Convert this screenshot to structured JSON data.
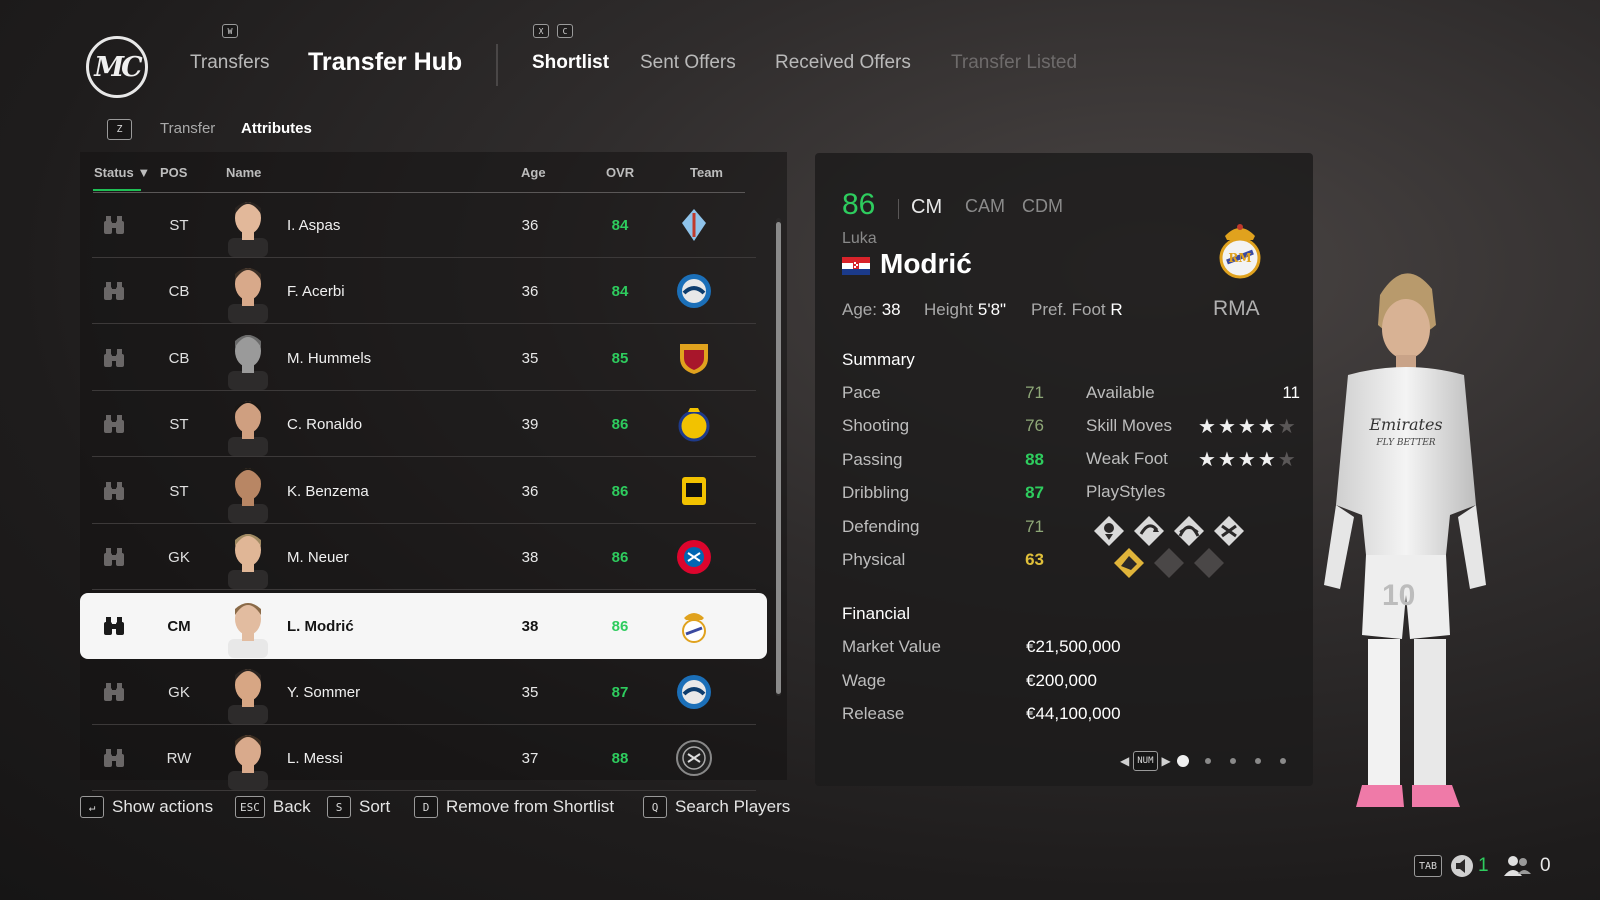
{
  "header": {
    "logo_text": "MC",
    "key_w": "W",
    "key_x": "X",
    "key_c": "C",
    "transfers": "Transfers",
    "title": "Transfer Hub",
    "tabs": [
      {
        "label": "Shortlist",
        "active": true
      },
      {
        "label": "Sent Offers"
      },
      {
        "label": "Received Offers"
      },
      {
        "label": "Transfer Listed",
        "disabled": true
      }
    ]
  },
  "subnav": {
    "key": "Z",
    "items": [
      {
        "label": "Transfer"
      },
      {
        "label": "Attributes",
        "active": true
      }
    ]
  },
  "table": {
    "columns": {
      "status": "Status",
      "pos": "POS",
      "name": "Name",
      "age": "Age",
      "ovr": "OVR",
      "team": "Team"
    },
    "rows": [
      {
        "pos": "ST",
        "name": "I. Aspas",
        "age": "36",
        "ovr": "84",
        "team_icon": "celta-vigo-crest"
      },
      {
        "pos": "CB",
        "name": "F. Acerbi",
        "age": "36",
        "ovr": "84",
        "team_icon": "inter-crest"
      },
      {
        "pos": "CB",
        "name": "M. Hummels",
        "age": "35",
        "ovr": "85",
        "team_icon": "roma-crest"
      },
      {
        "pos": "ST",
        "name": "C. Ronaldo",
        "age": "39",
        "ovr": "86",
        "team_icon": "al-nassr-crest"
      },
      {
        "pos": "ST",
        "name": "K. Benzema",
        "age": "36",
        "ovr": "86",
        "team_icon": "al-ittihad-crest"
      },
      {
        "pos": "GK",
        "name": "M. Neuer",
        "age": "38",
        "ovr": "86",
        "team_icon": "bayern-crest"
      },
      {
        "pos": "CM",
        "name": "L. Modrić",
        "age": "38",
        "ovr": "86",
        "team_icon": "real-madrid-crest",
        "selected": true
      },
      {
        "pos": "GK",
        "name": "Y. Sommer",
        "age": "35",
        "ovr": "87",
        "team_icon": "inter-crest"
      },
      {
        "pos": "RW",
        "name": "L. Messi",
        "age": "37",
        "ovr": "88",
        "team_icon": "inter-miami-crest"
      }
    ]
  },
  "actions": [
    {
      "key": "↵",
      "label": "Show actions"
    },
    {
      "key": "ESC",
      "label": "Back"
    },
    {
      "key": "S",
      "label": "Sort"
    },
    {
      "key": "D",
      "label": "Remove from Shortlist"
    },
    {
      "key": "Q",
      "label": "Search Players"
    }
  ],
  "player": {
    "ovr": "86",
    "position": "CM",
    "alt_positions": [
      "CAM",
      "CDM"
    ],
    "first_name": "Luka",
    "last_name": "Modrić",
    "nation_icon": "croatia-flag",
    "age_label": "Age:",
    "age": "38",
    "height_label": "Height",
    "height": "5'8\"",
    "foot_label": "Pref. Foot",
    "foot": "R",
    "club": "RMA",
    "summary_title": "Summary",
    "attributes": [
      {
        "label": "Pace",
        "value": "71",
        "tone": "low"
      },
      {
        "label": "Shooting",
        "value": "76",
        "tone": "low"
      },
      {
        "label": "Passing",
        "value": "88",
        "tone": "hi"
      },
      {
        "label": "Dribbling",
        "value": "87",
        "tone": "hi"
      },
      {
        "label": "Defending",
        "value": "71",
        "tone": "low"
      },
      {
        "label": "Physical",
        "value": "63",
        "tone": "yel"
      }
    ],
    "available_label": "Available",
    "available": "11",
    "skill_moves_label": "Skill Moves",
    "skill_moves": 4,
    "weak_foot_label": "Weak Foot",
    "weak_foot": 4,
    "playstyles_label": "PlayStyles",
    "financial_title": "Financial",
    "financial": [
      {
        "label": "Market Value",
        "value": "€21,500,000"
      },
      {
        "label": "Wage",
        "value": "€200,000"
      },
      {
        "label": "Release",
        "value": "€44,100,000"
      }
    ],
    "pager_key": "NUM",
    "pages": 5,
    "page": 1
  },
  "footer": {
    "tab_key": "TAB",
    "count_a": "1",
    "count_b": "0"
  },
  "colors": {
    "accent_green": "#2ecc5e",
    "yellow": "#e0c03a",
    "selected_row_bg": "#f6f6f6"
  }
}
